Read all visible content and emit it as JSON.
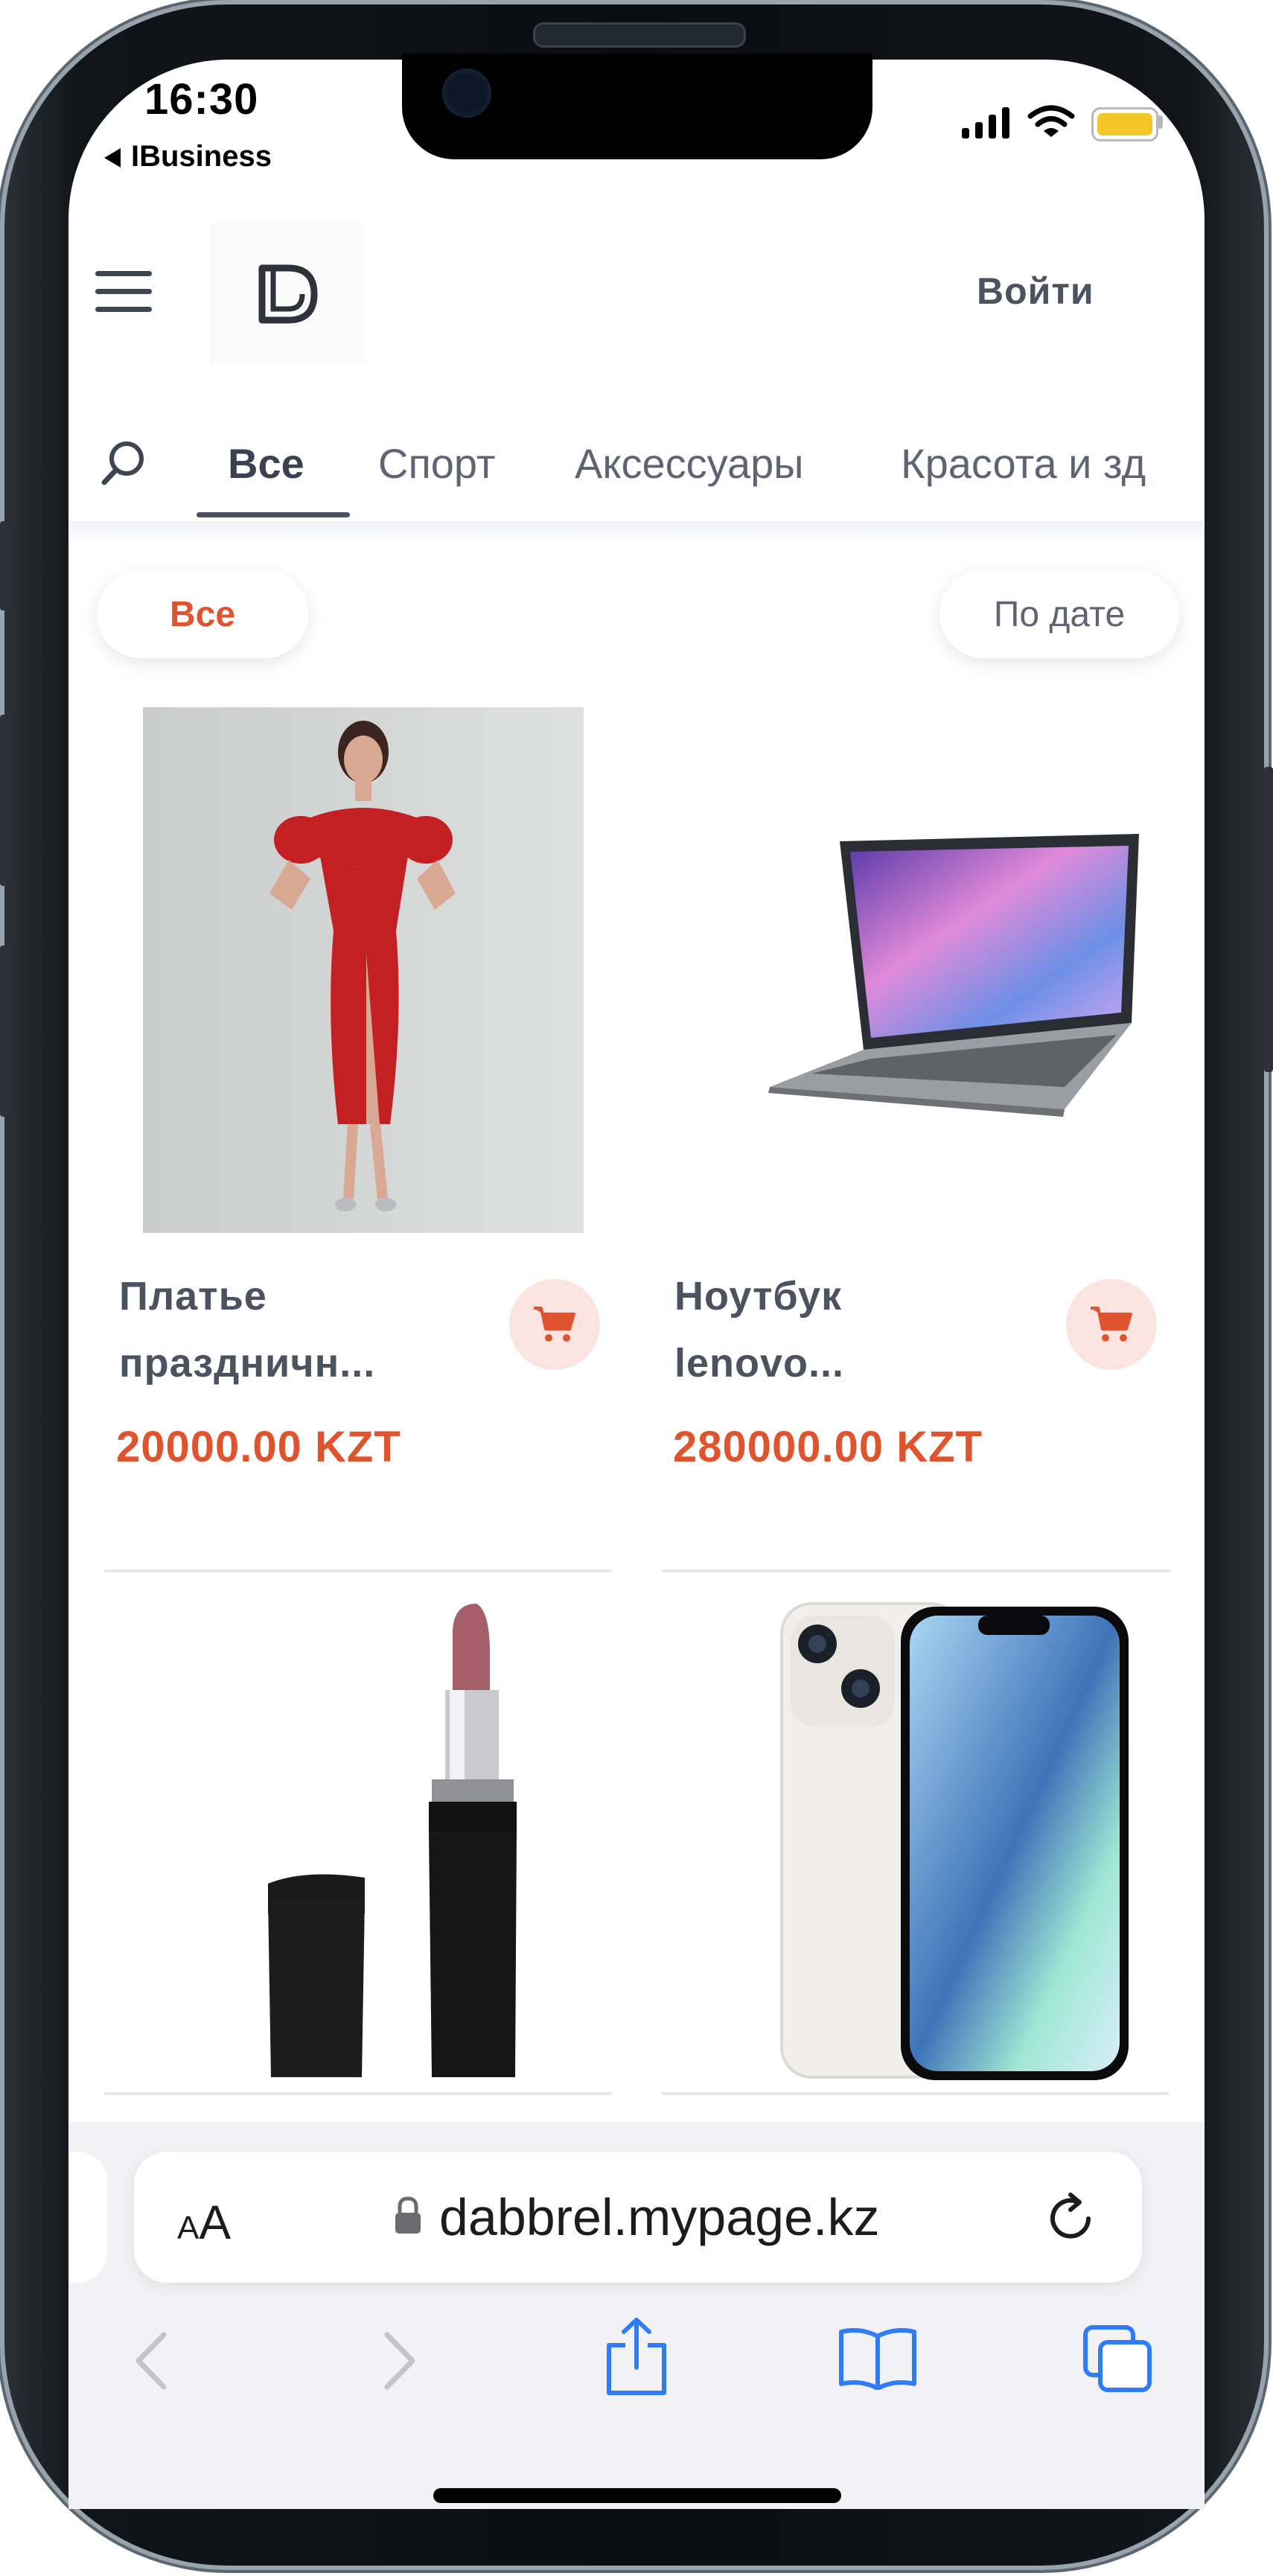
{
  "status_bar": {
    "time": "16:30",
    "back_app": "IBusiness"
  },
  "header": {
    "logo_text": "D",
    "login_label": "Войти"
  },
  "category_tabs": [
    "Все",
    "Спорт",
    "Аксессуары",
    "Красота и зд"
  ],
  "active_tab": "Все",
  "filters": {
    "category_filter": "Все",
    "sort_label": "По дате"
  },
  "products": [
    {
      "title_line1": "Платье",
      "title_line2": "праздничн...",
      "price": "20000.00 KZT",
      "image": "red-dress-photo"
    },
    {
      "title_line1": "Ноутбук",
      "title_line2": "lenovo...",
      "price": "280000.00 KZT",
      "image": "laptop-photo"
    },
    {
      "image": "lipstick-photo"
    },
    {
      "image": "iphone-photo"
    }
  ],
  "browser": {
    "text_size_label": "AA",
    "url": "dabbrel.mypage.kz"
  },
  "colors": {
    "accent": "#e0532f",
    "cart_bg": "#fbe3df",
    "text_dark": "#4b5360",
    "ios_blue": "#2f7cf6"
  },
  "icons": [
    "hamburger-menu-icon",
    "search-icon",
    "cart-icon",
    "lock-icon",
    "reload-icon",
    "back-arrow-icon",
    "forward-arrow-icon",
    "share-icon",
    "bookmarks-icon",
    "tabs-icon"
  ]
}
